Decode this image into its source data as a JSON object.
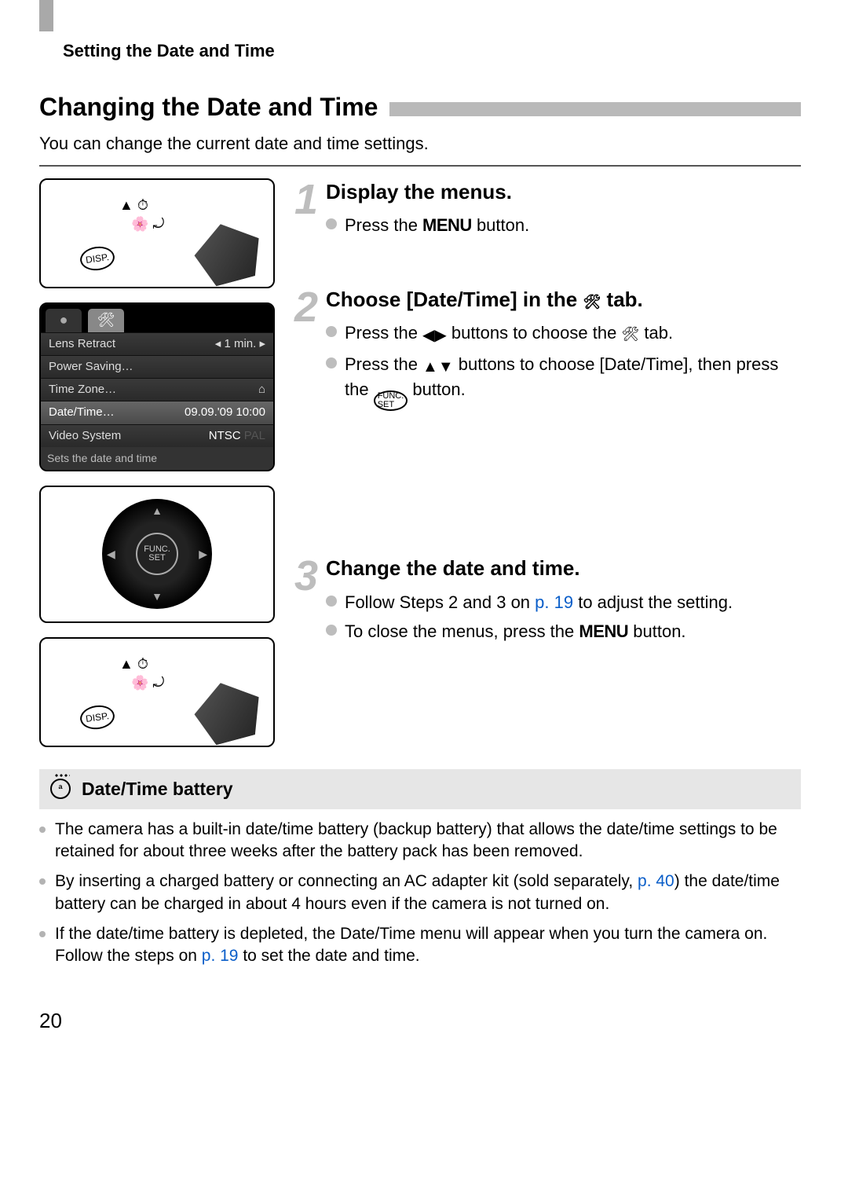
{
  "header": {
    "section_label": "Setting the Date and Time",
    "title": "Changing the Date and Time",
    "intro": "You can change the current date and time settings."
  },
  "camera_buttons": {
    "disp": "DISP.",
    "menu": "MENU"
  },
  "menu_screen": {
    "tabs": {
      "camera": "●",
      "tools": "🛠"
    },
    "rows": [
      {
        "label": "Lens Retract",
        "value": "◂ 1 min. ▸"
      },
      {
        "label": "Power Saving…",
        "value": ""
      },
      {
        "label": "Time Zone…",
        "value": "⌂"
      },
      {
        "label": "Date/Time…",
        "value": "09.09.'09 10:00"
      },
      {
        "label": "Video System",
        "value": "NTSC  PAL"
      }
    ],
    "help": "Sets the date and time"
  },
  "dial": {
    "func": "FUNC.",
    "set": "SET"
  },
  "steps": [
    {
      "num": "1",
      "title": "Display the menus.",
      "bullets": [
        {
          "pre": "Press the ",
          "kw": "MENU",
          "post": " button."
        }
      ]
    },
    {
      "num": "2",
      "title_pre": "Choose [Date/Time] in the ",
      "title_post": " tab.",
      "bullets": [
        {
          "pre": "Press the ",
          "arr": "◀▶",
          "mid": " buttons to choose the ",
          "tool_icon": true,
          "post": " tab."
        },
        {
          "pre": "Press the ",
          "arr": "▲▼",
          "mid": " buttons to choose [Date/Time], then press the ",
          "btn": "FUNC. SET",
          "post": " button."
        }
      ]
    },
    {
      "num": "3",
      "title": "Change the date and time.",
      "bullets": [
        {
          "pre": "Follow Steps 2 and 3 on ",
          "link": "p. 19",
          "post": " to adjust the setting."
        },
        {
          "pre": "To close the menus, press the ",
          "kw": "MENU",
          "post": " button."
        }
      ]
    }
  ],
  "tip": {
    "title": "Date/Time battery",
    "items": [
      "The camera has a built-in date/time battery (backup battery) that allows the date/time settings to be retained for about three weeks after the battery pack has been removed.",
      {
        "pre": "By inserting a charged battery or connecting an AC adapter kit (sold separately, ",
        "link": "p. 40",
        "post": ") the date/time battery can be charged in about 4 hours even if the camera is not turned on."
      },
      {
        "pre": "If the date/time battery is depleted, the Date/Time menu will appear when you turn the camera on. Follow the steps on ",
        "link": "p. 19",
        "post": " to set the date and time."
      }
    ]
  },
  "page_number": "20"
}
